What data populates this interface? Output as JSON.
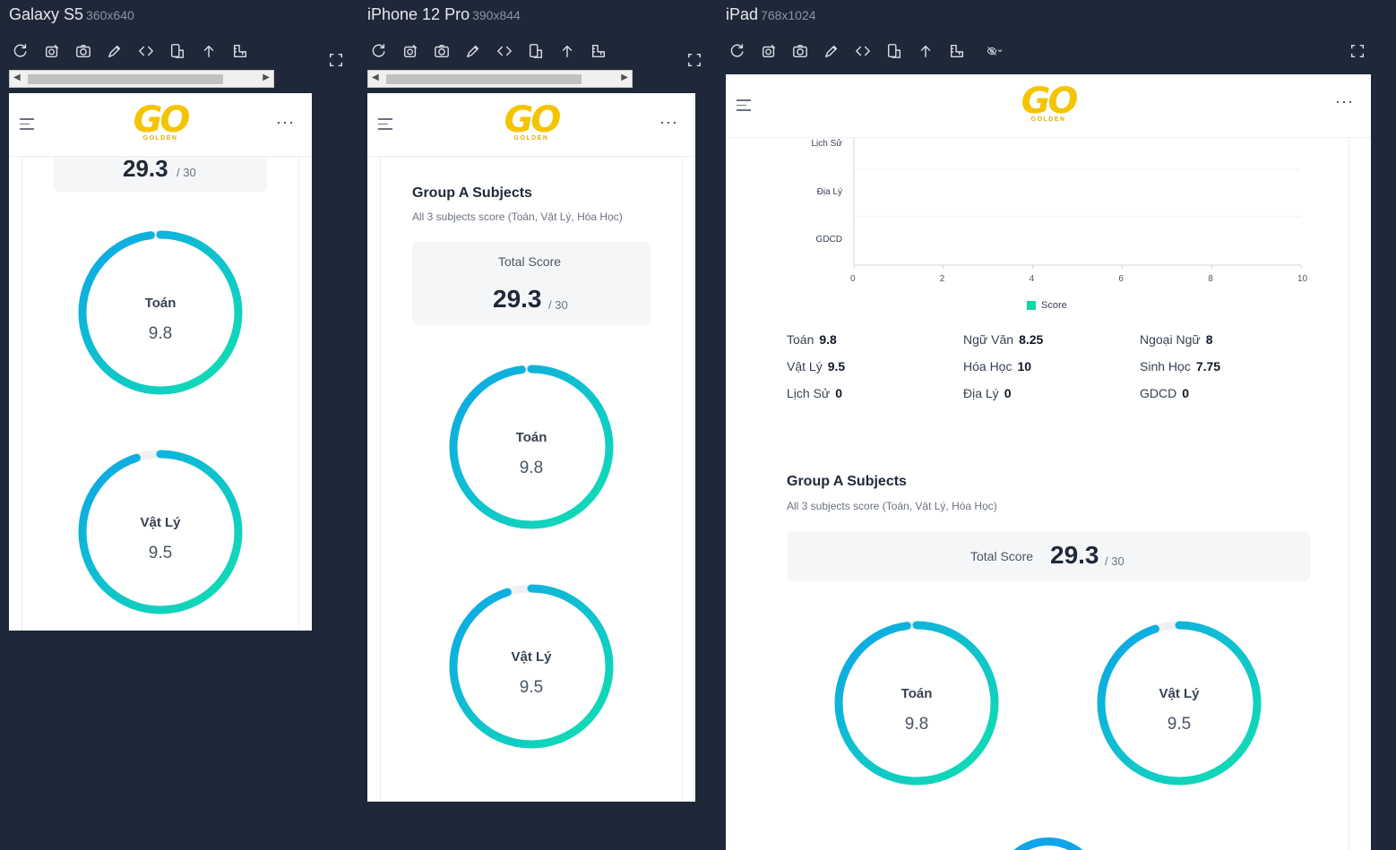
{
  "devices": [
    {
      "name": "Galaxy S5",
      "dims": "360x640"
    },
    {
      "name": "iPhone 12 Pro",
      "dims": "390x844"
    },
    {
      "name": "iPad",
      "dims": "768x1024"
    }
  ],
  "toolbar_icons": [
    "refresh-icon",
    "screenshot-settings-icon",
    "camera-icon",
    "color-picker-icon",
    "code-icon",
    "rotate-device-icon",
    "scroll-top-icon",
    "ruler-icon"
  ],
  "app": {
    "logo_text": "GO",
    "logo_subtext": "GOLDEN",
    "menu_dots": "···"
  },
  "group": {
    "title": "Group A Subjects",
    "subtitle": "All 3 subjects score (Toán, Vật Lý, Hóa Học)",
    "total_label": "Total Score",
    "total_score": "29.3",
    "total_max": "/ 30"
  },
  "rings": [
    {
      "subject": "Toán",
      "score": "9.8",
      "fraction": 0.98
    },
    {
      "subject": "Vật Lý",
      "score": "9.5",
      "fraction": 0.95
    }
  ],
  "chart_data": {
    "type": "bar",
    "orientation": "horizontal",
    "categories": [
      "Lịch Sử",
      "Địa Lý",
      "GDCD"
    ],
    "series": [
      {
        "name": "Score",
        "values": [
          0,
          0,
          0
        ]
      }
    ],
    "xlim": [
      0,
      10
    ],
    "xticks": [
      "0",
      "2",
      "4",
      "6",
      "8",
      "10"
    ],
    "legend_position": "bottom",
    "color": "#10d6a0"
  },
  "subject_scores": [
    {
      "subject": "Toán",
      "score": "9.8"
    },
    {
      "subject": "Ngữ Văn",
      "score": "8.25"
    },
    {
      "subject": "Ngoại Ngữ",
      "score": "8"
    },
    {
      "subject": "Vật Lý",
      "score": "9.5"
    },
    {
      "subject": "Hóa Học",
      "score": "10"
    },
    {
      "subject": "Sinh Học",
      "score": "7.75"
    },
    {
      "subject": "Lịch Sử",
      "score": "0"
    },
    {
      "subject": "Địa Lý",
      "score": "0"
    },
    {
      "subject": "GDCD",
      "score": "0"
    }
  ],
  "colors": {
    "ring_start": "#10e0b0",
    "ring_end": "#0ea5e9",
    "ring_track": "#eef0f3",
    "logo": "#f5c400"
  }
}
